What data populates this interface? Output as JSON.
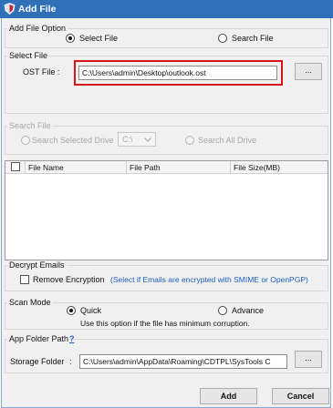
{
  "window": {
    "title": "Add File",
    "app_icon": "shield-icon"
  },
  "add_file_option": {
    "label": "Add File Option",
    "select_file": {
      "label": "Select File",
      "checked": true
    },
    "search_file": {
      "label": "Search File",
      "checked": false
    }
  },
  "select_file": {
    "label": "Select File",
    "ost_label": "OST File :",
    "ost_value": "C:\\Users\\admin\\Desktop\\outlook.ost",
    "browse_label": "..."
  },
  "search_file": {
    "label": "Search File",
    "search_selected_drive": "Search Selected Drive",
    "drive_value": "C:\\",
    "search_all_drive": "Search All Drive"
  },
  "file_table": {
    "columns": [
      "File Name",
      "File Path",
      "File Size(MB)"
    ],
    "rows": []
  },
  "decrypt": {
    "label": "Decrypt Emails",
    "remove_encryption": "Remove Encryption",
    "checked": false,
    "hint": "(Select if Emails are encrypted with SMIME or OpenPGP)"
  },
  "scan_mode": {
    "label": "Scan Mode",
    "quick": "Quick",
    "quick_checked": true,
    "advance": "Advance",
    "advance_checked": false,
    "hint": "Use this option if the file has minimum corruption."
  },
  "app_folder": {
    "label": "App Folder Path",
    "help": "?",
    "storage_label": "Storage Folder",
    "storage_colon": ":",
    "storage_value": "C:\\Users\\admin\\AppData\\Roaming\\CDTPL\\SysTools C",
    "browse_label": "..."
  },
  "buttons": {
    "add": "Add",
    "cancel": "Cancel"
  },
  "colors": {
    "titlebar": "#2f70b8",
    "highlight": "#d8141b",
    "hint": "#1f5fbd"
  }
}
